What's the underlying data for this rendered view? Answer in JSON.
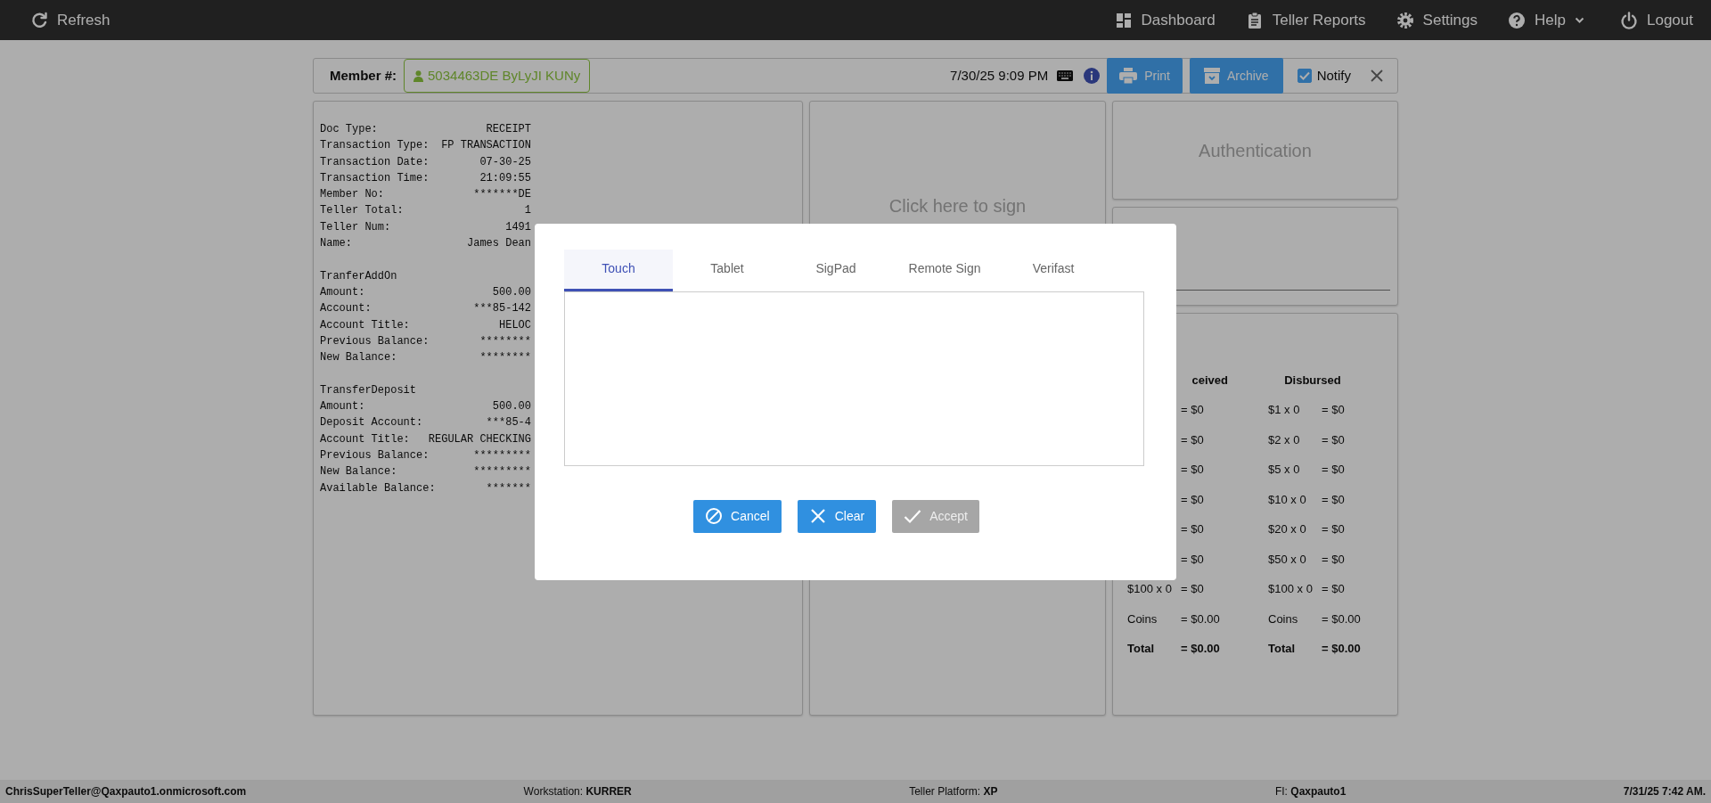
{
  "nav": {
    "refresh": {
      "label": "Refresh"
    },
    "dashboard": {
      "label": "Dashboard"
    },
    "reports": {
      "label": "Teller Reports"
    },
    "settings": {
      "label": "Settings"
    },
    "help": {
      "label": "Help"
    },
    "logout": {
      "label": "Logout"
    }
  },
  "member_bar": {
    "label": "Member #:",
    "member": "5034463DE ByLyJI KUNy",
    "datetime": "7/30/25 9:09 PM",
    "print": "Print",
    "archive": "Archive",
    "notify": {
      "label": "Notify",
      "checked": true
    }
  },
  "receipt": {
    "sections": [
      {
        "lines": [
          {
            "label": "Doc Type:",
            "value": "RECEIPT"
          },
          {
            "label": "Transaction Type:",
            "value": "FP TRANSACTION"
          },
          {
            "label": "Transaction Date:",
            "value": "07-30-25"
          },
          {
            "label": "Transaction Time:",
            "value": "21:09:55"
          },
          {
            "label": "Member No:",
            "value": "*******DE"
          },
          {
            "label": "Teller Total:",
            "value": "1"
          },
          {
            "label": "Teller Num:",
            "value": "1491"
          },
          {
            "label": "Name:",
            "value": "James Dean"
          }
        ]
      },
      {
        "heading": "TranferAddOn",
        "lines": [
          {
            "label": "Amount:",
            "value": "500.00"
          },
          {
            "label": "Account:",
            "value": "***85-142"
          },
          {
            "label": "Account Title:",
            "value": "HELOC"
          },
          {
            "label": "Previous Balance:",
            "value": "********"
          },
          {
            "label": "New Balance:",
            "value": "********"
          }
        ]
      },
      {
        "heading": "TransferDeposit",
        "lines": [
          {
            "label": "Amount:",
            "value": "500.00"
          },
          {
            "label": "Deposit Account:",
            "value": "***85-4"
          },
          {
            "label": "Account Title:",
            "value": "REGULAR CHECKING"
          },
          {
            "label": "Previous Balance:",
            "value": "*********"
          },
          {
            "label": "New Balance:",
            "value": "*********"
          },
          {
            "label": "Available Balance:",
            "value": "*******"
          }
        ]
      }
    ]
  },
  "signature_panel": {
    "prompt": "Click here to sign"
  },
  "authentication": {
    "title": "Authentication"
  },
  "cash": {
    "columns": [
      {
        "heading": "ceived",
        "rows": [
          {
            "kind": "line",
            "amount": "= $0"
          },
          {
            "kind": "line",
            "amount": "= $0"
          },
          {
            "kind": "line",
            "amount": "= $0"
          },
          {
            "kind": "line",
            "amount": "= $0"
          },
          {
            "kind": "line",
            "amount": "= $0"
          },
          {
            "kind": "line",
            "amount": "= $0"
          },
          {
            "kind": "line",
            "label": "$100 x 0",
            "amount": "= $0"
          },
          {
            "kind": "line",
            "label": "Coins",
            "amount": "= $0.00"
          },
          {
            "kind": "total",
            "label": "Total",
            "amount": "= $0.00"
          }
        ]
      },
      {
        "heading": "Disbursed",
        "rows": [
          {
            "kind": "line",
            "label": "$1 x 0",
            "amount": "= $0"
          },
          {
            "kind": "line",
            "label": "$2 x 0",
            "amount": "= $0"
          },
          {
            "kind": "line",
            "label": "$5 x 0",
            "amount": "= $0"
          },
          {
            "kind": "line",
            "label": "$10 x 0",
            "amount": "= $0"
          },
          {
            "kind": "line",
            "label": "$20 x 0",
            "amount": "= $0"
          },
          {
            "kind": "line",
            "label": "$50 x 0",
            "amount": "= $0"
          },
          {
            "kind": "line",
            "label": "$100 x 0",
            "amount": "= $0"
          },
          {
            "kind": "line",
            "label": "Coins",
            "amount": "= $0.00"
          },
          {
            "kind": "total",
            "label": "Total",
            "amount": "= $0.00"
          }
        ]
      }
    ]
  },
  "modal": {
    "tabs": [
      {
        "label": "Touch",
        "selected": true
      },
      {
        "label": "Tablet",
        "selected": false
      },
      {
        "label": "SigPad",
        "selected": false
      },
      {
        "label": "Remote Sign",
        "selected": false
      },
      {
        "label": "Verifast",
        "selected": false
      }
    ],
    "buttons": [
      {
        "kind": "cancel",
        "label": "Cancel",
        "disabled": false
      },
      {
        "kind": "clear",
        "label": "Clear",
        "disabled": false
      },
      {
        "kind": "accept",
        "label": "Accept",
        "disabled": true
      }
    ]
  },
  "status_bar": {
    "user": "ChrisSuperTeller@Qaxpauto1.onmicrosoft.com",
    "fields": [
      {
        "label": "Workstation:",
        "value": "KURRER"
      },
      {
        "label": "Teller Platform:",
        "value": "XP"
      },
      {
        "label": "FI:",
        "value": "Qaxpauto1"
      }
    ],
    "datetime": "7/31/25 7:42 AM."
  }
}
